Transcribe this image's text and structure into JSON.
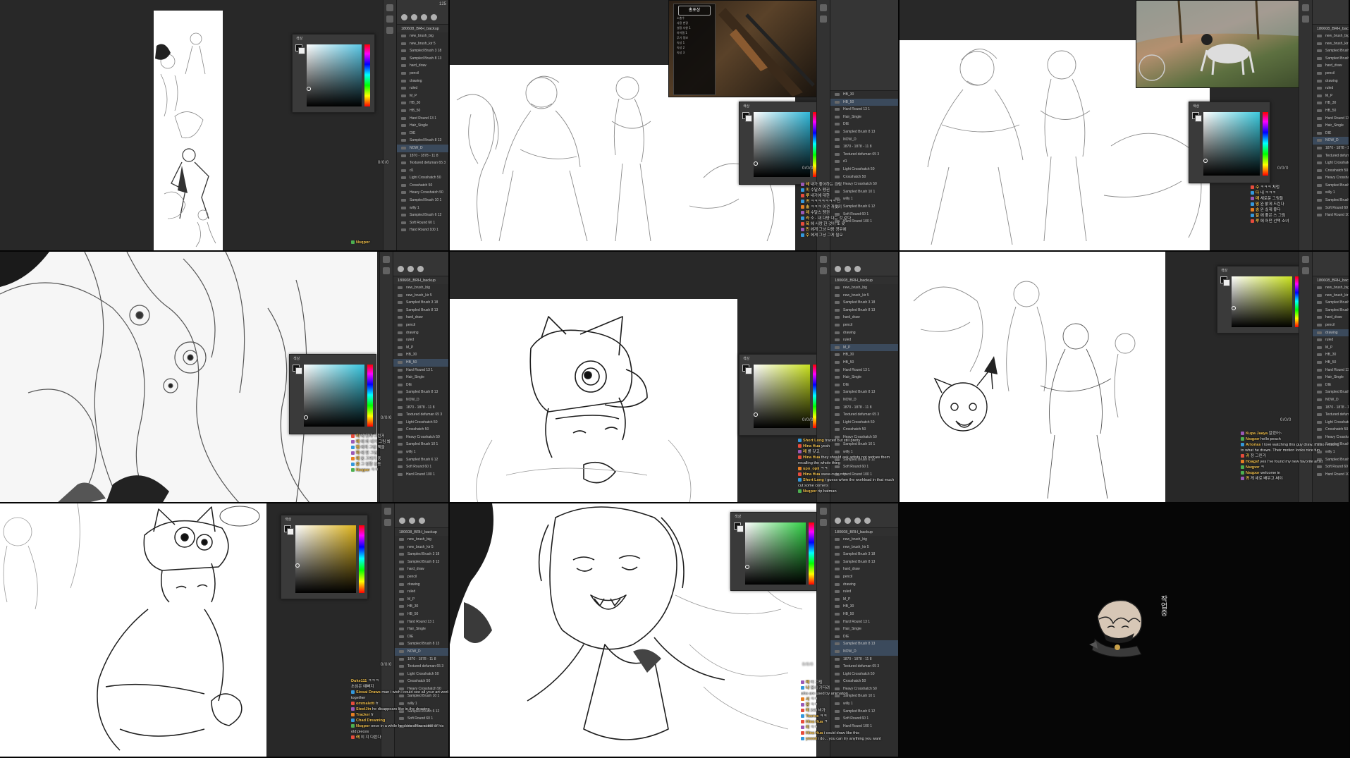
{
  "app": "Photoshop",
  "brush_panel": {
    "size_label": "125",
    "folder": "180608_BRH_backup",
    "brushes": [
      "new_brush_big",
      "new_brush_kir 5",
      "Sampled Brush 3 18",
      "Sampled Brush 8 13",
      "hard_draw",
      "pencil",
      "drawing",
      "ruled",
      "M_P",
      "HB_30",
      "HB_50",
      "Hard Round 13 1",
      "Hair_Single",
      "DIE",
      "Sampled Brush 8 13",
      "NOW_D",
      "1870 - 1878 - 11 8",
      "Textured defuman 65 3",
      "d1",
      "Light Crosshatch 50",
      "Crosshatch 50",
      "Heavy Crosshatch 50",
      "Sampled Brush 10 1",
      "willy 1",
      "Sampled Brush 6 12",
      "Soft Round 60 1",
      "Hard Round 100 1"
    ]
  },
  "color_picker": {
    "title": "색상"
  },
  "counter": "0/0/0",
  "hud": {
    "title": "총포상",
    "subtitle": "소총수",
    "lines": [
      "사용 변경",
      "설정 사항 1",
      "아이템 1",
      "무기 정보",
      "속성 1",
      "속성 2",
      "속성 3"
    ]
  },
  "chats": {
    "t2": [
      {
        "name": "레",
        "text": "내가 좋아하는 그림"
      },
      {
        "name": "미",
        "text": "수달스 펭귄"
      },
      {
        "name": "루",
        "text": "내가에 대한"
      },
      {
        "name": "귀",
        "text": "ㅋㅋㅋㅋㅋㅋㅋ 난"
      },
      {
        "name": "솔",
        "text": "ㅋㅋㅋ 이건 개웃기"
      },
      {
        "name": "래",
        "text": "수달스 펭귄"
      },
      {
        "name": "라",
        "text": "소 - 내 다양 다는 것 같다"
      },
      {
        "name": "폭",
        "text": "에 사랑 한 것이 또 맞"
      },
      {
        "name": "민",
        "text": "에게 그냥 다음 경우에"
      },
      {
        "name": "주",
        "text": "에게 그냥 그게 필요"
      }
    ],
    "t3": [
      {
        "name": "수",
        "text": "ㅋㅋㅋ 처럼"
      },
      {
        "name": "다",
        "text": "내 ㅋㅋㅋ"
      },
      {
        "name": "매",
        "text": "새로운 그림들"
      },
      {
        "name": "밍",
        "text": "완 밝게 드린다"
      },
      {
        "name": "송",
        "text": "완 실제 좋다"
      },
      {
        "name": "칼",
        "text": "에 좋은 스 그림"
      },
      {
        "name": "루",
        "text": "에 어떤 선택 소녀"
      }
    ],
    "t4": [
      {
        "name": "이",
        "text": "에 진짜 그린거"
      },
      {
        "name": "레",
        "text": "에 와 내가 그림 봐"
      },
      {
        "name": "펠",
        "text": "에게 그림 책을"
      },
      {
        "name": "하",
        "text": "에 한 그림"
      },
      {
        "name": "레",
        "text": "중 그리기 중"
      },
      {
        "name": "준",
        "text": "그 정말 감동"
      }
    ],
    "t5": [
      {
        "name": "Short Long",
        "text": "traced but still pretty"
      },
      {
        "name": "Hina Hua",
        "text": "yeah"
      },
      {
        "name": "레",
        "text": "를 갖고"
      },
      {
        "name": "Hina Hua",
        "text": "they should ask artists not redraw them"
      },
      {
        "name": "",
        "text": "recalling the whole thing"
      },
      {
        "name": "upo_opii",
        "text": "ㅋㅋ"
      },
      {
        "name": "Hina Hua",
        "text": "wasa cute cop"
      },
      {
        "name": "Short Long",
        "text": "i guess when the workload in that much"
      },
      {
        "name": "",
        "text": "cut some corners"
      },
      {
        "name": "Nsqpor",
        "text": "rip batman"
      }
    ],
    "t6": [
      {
        "name": "Kupa Jaaya",
        "text": "알겠어~"
      },
      {
        "name": "Nsqpor",
        "text": "hello peach"
      },
      {
        "name": "Artorias",
        "text": "I love watching this guy draw, it's so relaxing"
      },
      {
        "name": "",
        "text": "to what he draws. Their motion looks nice fun."
      },
      {
        "name": "귀",
        "text": "정 그린거"
      },
      {
        "name": "Hoagsf",
        "text": "yes I've found my new favorite artist"
      },
      {
        "name": "Nsqpor",
        "text": "ㅋ"
      },
      {
        "name": "Nsqpor",
        "text": "welcome in"
      },
      {
        "name": "귀",
        "text": "게 새로 배우고 써야"
      }
    ],
    "t7": [
      {
        "name": "Duke111",
        "text": "ㅋㅋㅋ"
      },
      {
        "name": "",
        "text": "초심은 예뻐지"
      },
      {
        "name": "Siosai Draws",
        "text": "man i wish i could see all your art work"
      },
      {
        "name": "",
        "text": "together"
      },
      {
        "name": "ommaletti",
        "text": "fr"
      },
      {
        "name": "SteelJin",
        "text": "he disappears like in the drawing"
      },
      {
        "name": "Tracker",
        "text": "fr"
      },
      {
        "name": "Chad Dreaming",
        "text": ""
      },
      {
        "name": "Nsqpor",
        "text": "once in a while he does show some of his"
      },
      {
        "name": "",
        "text": "old pieces"
      },
      {
        "name": "래",
        "text": "이 지 다른다"
      }
    ],
    "t8": [
      {
        "name": "레",
        "text": "이 그림"
      },
      {
        "name": "나",
        "text": "잠시 기다려"
      },
      {
        "name": "",
        "text": "who are used by animation"
      },
      {
        "name": "시",
        "text": "ㅋㅋ"
      },
      {
        "name": "장",
        "text": "ㅋㅋ"
      },
      {
        "name": "미",
        "text": "240 비가"
      },
      {
        "name": "Taurus",
        "text": "ㅋㅋ"
      },
      {
        "name": "Hina Hua",
        "text": "ㅋ"
      },
      {
        "name": "이",
        "text": "ㅋㅋ"
      },
      {
        "name": "Hina Hua",
        "text": "i could draw like this"
      },
      {
        "name": "yeeed",
        "text": "i do... you can try anything you want"
      }
    ],
    "t4b": [
      {
        "name": "Nsqpor",
        "text": "ㅋㅋ"
      }
    ]
  },
  "mascot": {
    "text": "작업중"
  },
  "chat_user_short": "Nsqpor",
  "colors": {
    "t1_hue": "#5ac8e6",
    "t2_hue": "#2fb7d8",
    "t3_hue": "#3cc9dd",
    "t4_hue": "#35c4dd",
    "t5_hue": "#c8e01e",
    "t6_hue": "#c9e21f",
    "t7_hue": "#dcb21a",
    "t8_hue": "#2ecf43"
  }
}
